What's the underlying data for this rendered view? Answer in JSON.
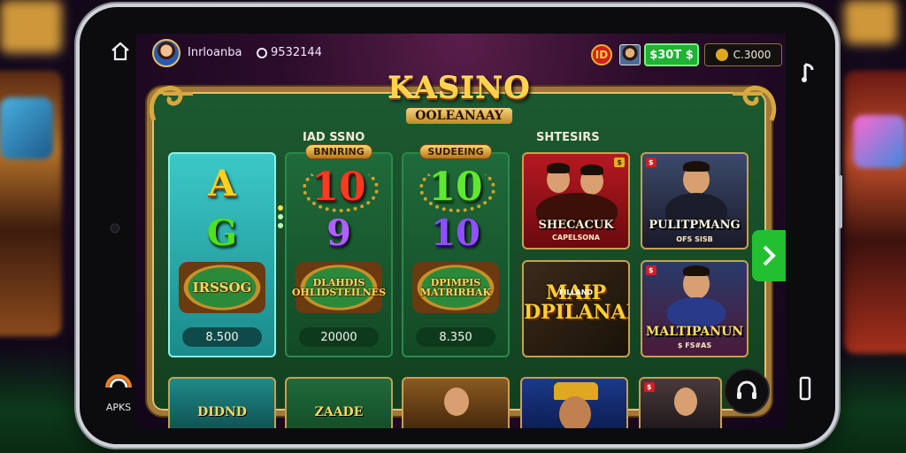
{
  "app": {
    "logo_title": "KASINO",
    "logo_subtitle": "OOLEANAAY"
  },
  "bezel": {
    "left_label": "APKS"
  },
  "topbar": {
    "username": "Inrloanba",
    "coins": "9532144",
    "bag_label": "ID",
    "cash": "$30T $",
    "gold": "C.3000"
  },
  "sections": {
    "left_label": "IAD SSNO",
    "right_label": "SHTESIRS"
  },
  "slots": [
    {
      "header": "",
      "symbols": [
        "A",
        "G"
      ],
      "badge": "IRSSOG",
      "amount": "8.500"
    },
    {
      "header": "BNNRING",
      "symbols": [
        "10",
        "9"
      ],
      "badge": "DLAHDIS OHLIDSTEILNES",
      "amount": "20000"
    },
    {
      "header": "SUDEEING",
      "symbols": [
        "10",
        "10"
      ],
      "badge": "DPIMPIS MATRIRHAK",
      "amount": "8.350"
    }
  ],
  "tiles": [
    {
      "title": "SHECACUK",
      "subtitle": "CAPELSONA",
      "tag": "$"
    },
    {
      "title": "PULITPMANG",
      "subtitle": "OFS SISB",
      "tag": "$"
    },
    {
      "title": "MAIP DPILANAN",
      "subtitle": "FILLAND",
      "tag": "$"
    },
    {
      "title": "MALTIPANUN",
      "subtitle": "$ FS#AS",
      "tag": "$"
    }
  ],
  "bottom_row": [
    {
      "text": "DIDND"
    },
    {
      "text": "ZAADE"
    },
    {
      "text": ""
    },
    {
      "text": ""
    },
    {
      "text": ""
    }
  ],
  "colors": {
    "felt": "#1c5a30",
    "gold_frame": "#a07838",
    "cash_green": "#1fb234",
    "next_green": "#22c030"
  },
  "icons": {
    "home": "home-icon",
    "lyric": "music-note-icon",
    "phone": "phone-icon",
    "support": "headset-icon",
    "next": "chevron-right-icon"
  }
}
